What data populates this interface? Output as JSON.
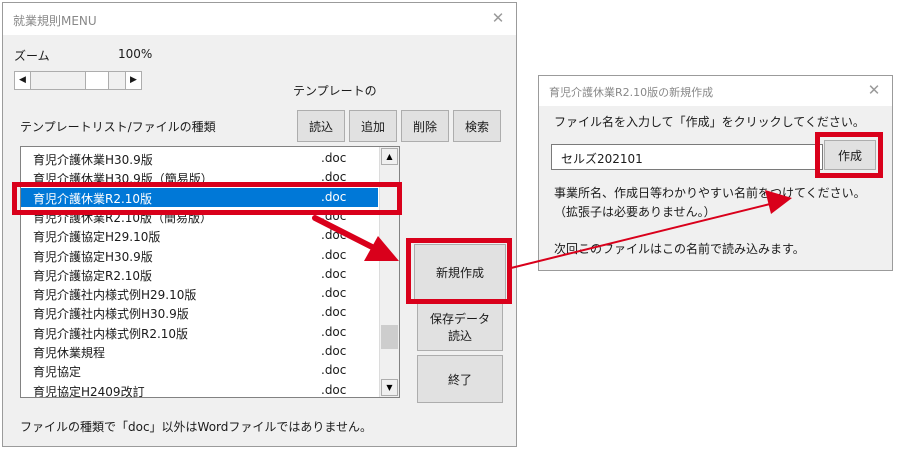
{
  "main": {
    "title": "就業規則MENU",
    "zoom_label": "ズーム",
    "zoom_value": "100%",
    "template_caption": "テンプレートの",
    "list_caption": "テンプレートリスト/ファイルの種類",
    "buttons": {
      "read": "読込",
      "add": "追加",
      "delete": "削除",
      "search": "検索",
      "new": "新規作成",
      "save_data_1": "保存データ",
      "save_data_2": "読込",
      "end": "終了"
    },
    "list": [
      {
        "name": "育児介護休業H30.9版",
        "type": ".doc"
      },
      {
        "name": "育児介護休業H30.9版（簡易版）",
        "type": ".doc"
      },
      {
        "name": "育児介護休業R2.10版",
        "type": ".doc"
      },
      {
        "name": "育児介護休業R2.10版（簡易版）",
        "type": ".doc"
      },
      {
        "name": "育児介護協定H29.10版",
        "type": ".doc"
      },
      {
        "name": "育児介護協定H30.9版",
        "type": ".doc"
      },
      {
        "name": "育児介護協定R2.10版",
        "type": ".doc"
      },
      {
        "name": "育児介護社内様式例H29.10版",
        "type": ".doc"
      },
      {
        "name": "育児介護社内様式例H30.9版",
        "type": ".doc"
      },
      {
        "name": "育児介護社内様式例R2.10版",
        "type": ".doc"
      },
      {
        "name": "育児休業規程",
        "type": ".doc"
      },
      {
        "name": "育児協定",
        "type": ".doc"
      },
      {
        "name": "育児協定H2409改訂",
        "type": ".doc"
      }
    ],
    "selected_index": 2,
    "zoom_slider_level_percent": 30,
    "footer_note": "ファイルの種類で「doc」以外はWordファイルではありません。",
    "close_icon": "close-icon"
  },
  "newfile": {
    "title": "育児介護休業R2.10版の新規作成",
    "instruction": "ファイル名を入力して「作成」をクリックしてください。",
    "filename_value": "セルズ202101",
    "create_button": "作成",
    "hint_1": "事業所名、作成日等わかりやすい名前をつけてください。",
    "hint_2": "（拡張子は必要ありません。）",
    "hint_3": "次回このファイルはこの名前で読み込みます。"
  },
  "colors": {
    "highlight_red": "#d9001b",
    "selection_blue": "#0078d7",
    "dialog_bg": "#f0f0f0"
  }
}
